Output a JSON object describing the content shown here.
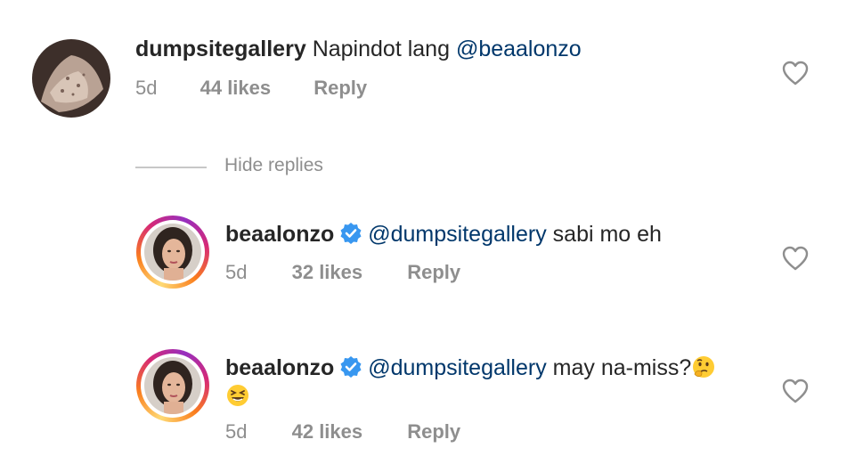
{
  "comments": [
    {
      "username": "dumpsitegallery",
      "text_before": "Napindot lang",
      "mention": "@beaalonzo",
      "text_after": "",
      "age": "5d",
      "likes": "44 likes",
      "reply": "Reply"
    }
  ],
  "hide_replies": "Hide replies",
  "replies": [
    {
      "username": "beaalonzo",
      "mention": "@dumpsitegallery",
      "text": "sabi mo eh",
      "age": "5d",
      "likes": "32 likes",
      "reply": "Reply"
    },
    {
      "username": "beaalonzo",
      "mention": "@dumpsitegallery",
      "text": "may na-miss?",
      "age": "5d",
      "likes": "42 likes",
      "reply": "Reply",
      "emojis": [
        "thinking-face-emoji",
        "laughing-squint-emoji"
      ]
    }
  ],
  "colors": {
    "mention": "#00376b",
    "meta": "#8e8e8e",
    "verified": "#3897f0"
  }
}
